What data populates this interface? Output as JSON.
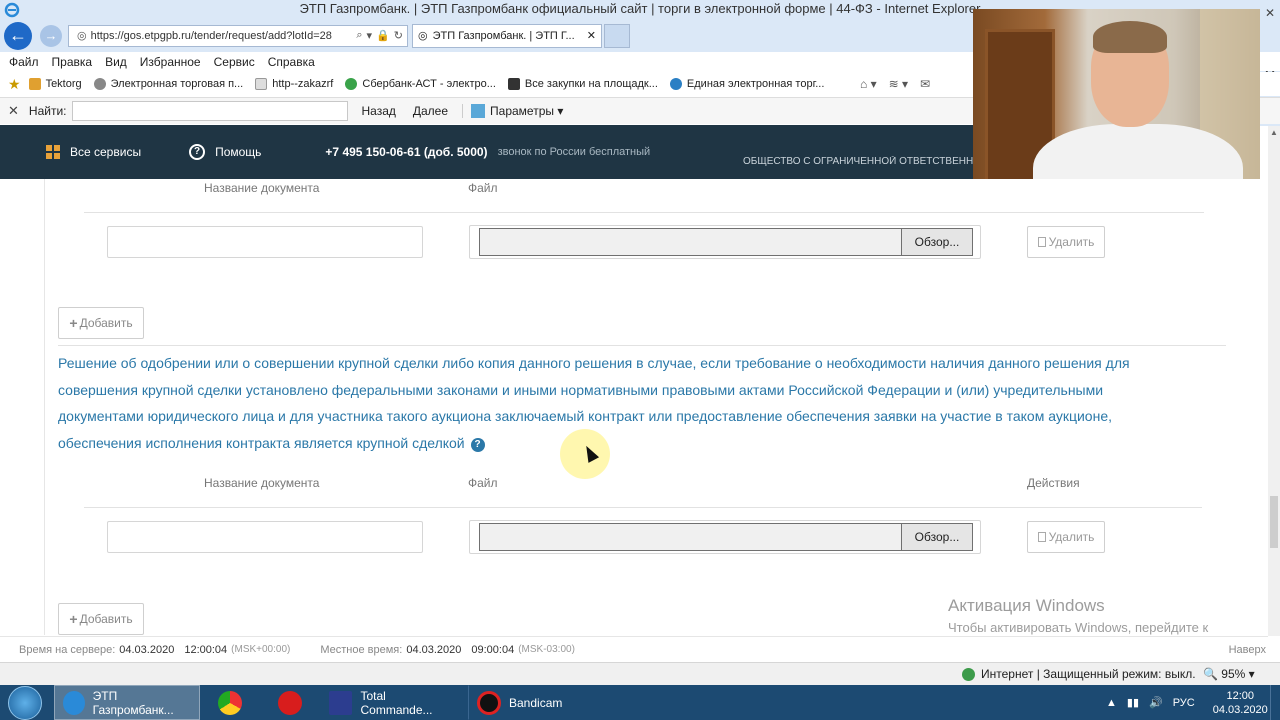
{
  "window": {
    "title": "ЭТП Газпромбанк. | ЭТП Газпромбанк официальный сайт | торги в электронной форме | 44-ФЗ - Internet Explorer"
  },
  "browser": {
    "url": "https://gos.etpgpb.ru/tender/request/add?lotId=28",
    "tab_label": "ЭТП Газпромбанк. | ЭТП Г...",
    "menu": [
      "Файл",
      "Правка",
      "Вид",
      "Избранное",
      "Сервис",
      "Справка"
    ],
    "favorites": [
      "Tektorg",
      "Электронная торговая п...",
      "http--zakazrf",
      "Сбербанк-АСТ - электро...",
      "Все закупки на площадк...",
      "Единая электронная торг..."
    ],
    "find": {
      "label": "Найти:",
      "prev": "Назад",
      "next": "Далее",
      "params": "Параметры"
    }
  },
  "site_header": {
    "all_services": "Все сервисы",
    "help": "Помощь",
    "phone": "+7 495 150-06-61 (доб. 5000)",
    "phone_note": "звонок по России бесплатный",
    "org": "ОБЩЕСТВО С ОГРАНИЧЕННОЙ ОТВЕТСТВЕННОСТЬЮ"
  },
  "docs_section_1": {
    "col_name": "Название документа",
    "col_file": "Файл",
    "browse": "Обзор...",
    "delete": "Удалить",
    "add": "Добавить"
  },
  "docs_section_2": {
    "description": "Решение об одобрении или о совершении крупной сделки либо копия данного решения в случае, если требование о необходимости наличия данного решения для совершения крупной сделки установлено федеральными законами и иными нормативными правовыми актами Российской Федерации и (или) учредительными документами юридического лица и для участника такого аукциона заключаемый контракт или предоставление обеспечения заявки на участие в таком аукционе, обеспечения исполнения контракта является крупной сделкой",
    "col_name": "Название документа",
    "col_file": "Файл",
    "col_actions": "Действия",
    "browse": "Обзор...",
    "delete": "Удалить",
    "add": "Добавить"
  },
  "activation": {
    "title": "Активация Windows",
    "text": "Чтобы активировать Windows, перейдите к параметрам компьютера."
  },
  "server_bar": {
    "server_label": "Время на сервере:",
    "server_date": "04.03.2020",
    "server_time": "12:00:04",
    "server_tz": "(MSK+00:00)",
    "local_label": "Местное время:",
    "local_date": "04.03.2020",
    "local_time": "09:00:04",
    "local_tz": "(MSK-03:00)",
    "up": "Наверх"
  },
  "ie_status": {
    "zone": "Интернет | Защищенный режим: выкл.",
    "zoom": "95%"
  },
  "taskbar": {
    "items": [
      {
        "label": "ЭТП Газпромбанк..."
      },
      {
        "label": ""
      },
      {
        "label": ""
      },
      {
        "label": "Total Commande..."
      },
      {
        "label": "Bandicam"
      }
    ],
    "lang": "РУС",
    "time": "12:00",
    "date": "04.03.2020"
  },
  "colors": {
    "header_bg": "#1f3544",
    "link_blue": "#2b78a8",
    "taskbar": "#1c4a72"
  }
}
